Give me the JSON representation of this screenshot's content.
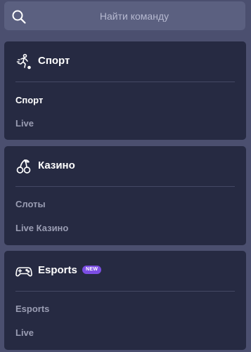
{
  "search": {
    "placeholder": "Найти команду",
    "icon": "search-icon"
  },
  "sections": [
    {
      "title": "Спорт",
      "icon": "soccer-player-icon",
      "items": [
        {
          "label": "Спорт",
          "active": true
        },
        {
          "label": "Live",
          "active": false
        }
      ]
    },
    {
      "title": "Казино",
      "icon": "cherry-icon",
      "items": [
        {
          "label": "Слоты",
          "active": false
        },
        {
          "label": "Live Казино",
          "active": false
        }
      ]
    },
    {
      "title": "Esports",
      "icon": "gamepad-icon",
      "badge": "NEW",
      "items": [
        {
          "label": "Esports",
          "active": false
        },
        {
          "label": "Live",
          "active": false
        }
      ]
    }
  ],
  "colors": {
    "background": "#4b4f6f",
    "card": "#262a42",
    "active_text": "#ffffff",
    "inactive_text": "#9a9db3",
    "badge": "#7c4ee4"
  }
}
